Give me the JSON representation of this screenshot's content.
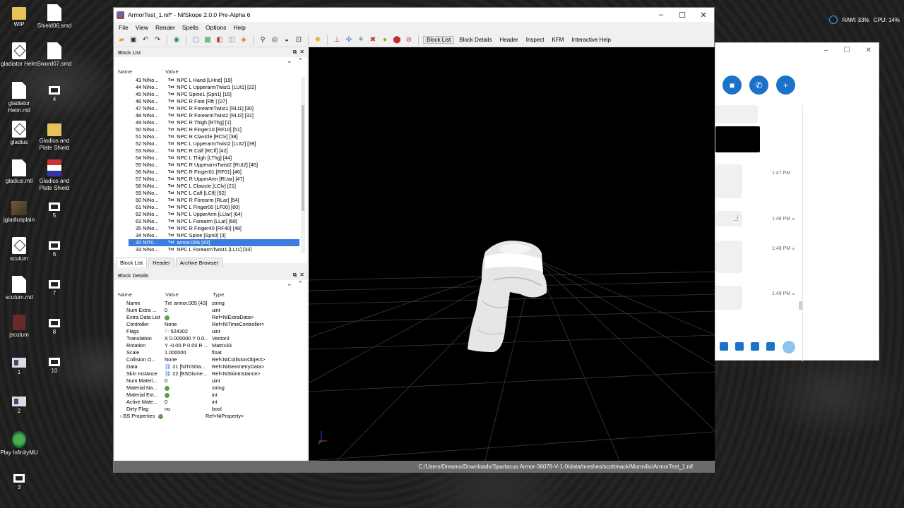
{
  "desktop_icons": [
    {
      "label": "WIP",
      "kind": "folder"
    },
    {
      "label": "Shield06.smd",
      "kind": "doc"
    },
    {
      "label": "gladiator Helm",
      "kind": "cube"
    },
    {
      "label": "Sword07.smd",
      "kind": "doc"
    },
    {
      "label": "gladiator Helm.mtl",
      "kind": "doc"
    },
    {
      "label": "4",
      "kind": "shortcut"
    },
    {
      "label": "gladius",
      "kind": "cube"
    },
    {
      "label": "Gladius and Plate Shield",
      "kind": "folder"
    },
    {
      "label": "gladius.mtl",
      "kind": "doc"
    },
    {
      "label": "Gladius and Plate Shield",
      "kind": "flag"
    },
    {
      "label": "jgladiusplain",
      "kind": "img"
    },
    {
      "label": "5",
      "kind": "shortcut"
    },
    {
      "label": "scutum",
      "kind": "cube"
    },
    {
      "label": "6",
      "kind": "shortcut"
    },
    {
      "label": "scutum.mtl",
      "kind": "doc"
    },
    {
      "label": "7",
      "kind": "shortcut"
    },
    {
      "label": "jscutum",
      "kind": "red"
    },
    {
      "label": "8",
      "kind": "shortcut"
    },
    {
      "label": "1",
      "kind": "screen"
    },
    {
      "label": "10",
      "kind": "shortcut"
    },
    {
      "label": "2",
      "kind": "screen"
    },
    {
      "label": "Play InfinityMU",
      "kind": "play"
    },
    {
      "label": "3",
      "kind": "shortcut"
    }
  ],
  "tray": {
    "ram": "RAM: 33%",
    "cpu": "CPU: 14%"
  },
  "chat": {
    "times": [
      "1:47 PM",
      "1:48 PM",
      "1:48 PM",
      "1:49 PM"
    ],
    "snippet": "_i",
    "accent": "#1a73c8"
  },
  "window": {
    "title": "ArmorTest_1.nif* - NifSkope 2.0.0 Pre-Alpha 6",
    "minimize": "–",
    "maximize": "☐",
    "close": "✕"
  },
  "menu": [
    "File",
    "View",
    "Render",
    "Spells",
    "Options",
    "Help"
  ],
  "toolbar_tabs": [
    "Block List",
    "Block Details",
    "Header",
    "Inspect",
    "KFM",
    "Interactive Help"
  ],
  "block_list": {
    "title": "Block List",
    "col_name": "Name",
    "col_value": "Value",
    "rows": [
      {
        "name": "43 NiNo...",
        "value": "NPC L Hand [LHnd] [19]"
      },
      {
        "name": "44 NiNo...",
        "value": "NPC L UpperarmTwist1 [LUt1] [22]"
      },
      {
        "name": "45 NiNo...",
        "value": "NPC Spine1 [Spn1] [15]"
      },
      {
        "name": "46 NiNo...",
        "value": "NPC R Foot [Rft ] [27]"
      },
      {
        "name": "47 NiNo...",
        "value": "NPC R ForearmTwist1 [RLt1] [30]"
      },
      {
        "name": "48 NiNo...",
        "value": "NPC R ForearmTwist2 [RLt2] [31]"
      },
      {
        "name": "49 NiNo...",
        "value": "NPC R Thigh [RThg] [1]"
      },
      {
        "name": "50 NiNo...",
        "value": "NPC R Finger10 [RF10] [51]"
      },
      {
        "name": "51 NiNo...",
        "value": "NPC R Clavicle [RClv] [38]"
      },
      {
        "name": "52 NiNo...",
        "value": "NPC L UpperarmTwist2 [LUt2] [39]"
      },
      {
        "name": "53 NiNo...",
        "value": "NPC R Calf [RClf] [42]"
      },
      {
        "name": "54 NiNo...",
        "value": "NPC L Thigh [LThg] [44]"
      },
      {
        "name": "55 NiNo...",
        "value": "NPC R UpperarmTwist2 [RUt2] [45]"
      },
      {
        "name": "56 NiNo...",
        "value": "NPC R Finger01 [RF01] [46]"
      },
      {
        "name": "57 NiNo...",
        "value": "NPC R UpperArm [RUar] [47]"
      },
      {
        "name": "58 NiNo...",
        "value": "NPC L Clavicle [LClv] [21]"
      },
      {
        "name": "59 NiNo...",
        "value": "NPC L Calf [LClf] [52]"
      },
      {
        "name": "60 NiNo...",
        "value": "NPC R Forearm [RLar] [54]"
      },
      {
        "name": "61 NiNo...",
        "value": "NPC L Finger00 [LF00] [60]"
      },
      {
        "name": "62 NiNo...",
        "value": "NPC L UpperArm [LUar] [64]"
      },
      {
        "name": "63 NiNo...",
        "value": "NPC L Forearm [LLar] [68]"
      },
      {
        "name": "35 NiNo...",
        "value": "NPC R Finger40 [RF40] [48]"
      },
      {
        "name": "34 NiNo...",
        "value": "NPC Spine [Spn0] [3]"
      },
      {
        "name": "20 NiTri...",
        "value": "armor.005 [43]",
        "selected": true
      },
      {
        "name": "33 NiNo...",
        "value": "NPC L ForearmTwist1 [LLt1] [33]"
      }
    ],
    "tabs": [
      "Block List",
      "Header",
      "Archive Browser"
    ]
  },
  "block_details": {
    "title": "Block Details",
    "col_name": "Name",
    "col_value": "Value",
    "col_type": "Type",
    "rows": [
      {
        "name": "Name",
        "value": "armor.005 [43]",
        "type": "string",
        "tag": "Txt"
      },
      {
        "name": "Num Extra ...",
        "value": "0",
        "type": "uint"
      },
      {
        "name": "Extra Data List",
        "value": "",
        "type": "Ref<NiExtraData>",
        "gear": true
      },
      {
        "name": "Controller",
        "value": "None",
        "type": "Ref<NiTimeController>"
      },
      {
        "name": "Flags",
        "value": "524302",
        "type": "uint",
        "flag": true
      },
      {
        "name": "Translation",
        "value": "X 0.000000 Y 0.0...",
        "type": "Vector3"
      },
      {
        "name": "Rotation",
        "value": "Y -0.00 P 0.00 R ...",
        "type": "Matrix33"
      },
      {
        "name": "Scale",
        "value": "1.000000",
        "type": "float"
      },
      {
        "name": "Collision O...",
        "value": "None",
        "type": "Ref<NiCollisionObject>"
      },
      {
        "name": "Data",
        "value": "21 [NiTriSha...",
        "type": "Ref<NiGeometryData>",
        "link": true
      },
      {
        "name": "Skin Instance",
        "value": "22 [BSDisme...",
        "type": "Ref<NiSkinInstance>",
        "link": true
      },
      {
        "name": "Num Materi...",
        "value": "0",
        "type": "uint"
      },
      {
        "name": "Material Na...",
        "value": "",
        "type": "string",
        "gear": true
      },
      {
        "name": "Material Ext...",
        "value": "",
        "type": "int",
        "gear": true
      },
      {
        "name": "Active Mate...",
        "value": "0",
        "type": "int"
      },
      {
        "name": "Dirty Flag",
        "value": "no",
        "type": "bool"
      },
      {
        "name": "BS Properties",
        "value": "",
        "type": "Ref<NiProperty>",
        "gear": true,
        "expandable": true
      }
    ]
  },
  "statusbar": "C:/Users/Dreams/Downloads/Spartacus Armor-36079-V-1-0/data/meshes/scottmack/Murmillo/ArmorTest_1.nif"
}
